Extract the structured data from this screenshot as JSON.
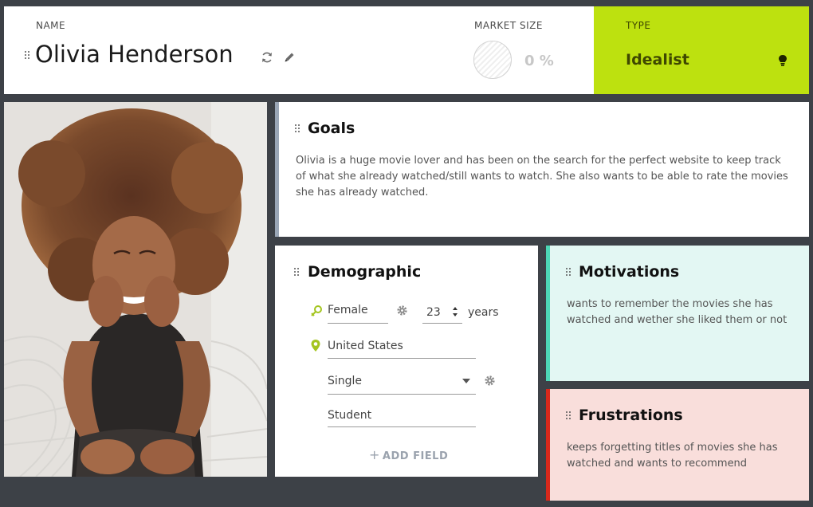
{
  "header": {
    "name_caption": "NAME",
    "persona_name": "Olivia Henderson",
    "market_size_caption": "MARKET SIZE",
    "market_size_value": "0 %",
    "type_caption": "TYPE",
    "type_value": "Idealist"
  },
  "goals": {
    "title": "Goals",
    "text": "Olivia is a huge movie lover and has been on the search for the perfect website to keep track of what she already watched/still wants to watch. She also wants to be able to rate the movies she has already watched."
  },
  "demographic": {
    "title": "Demographic",
    "gender": "Female",
    "age": "23",
    "age_unit": "years",
    "location": "United States",
    "relationship": "Single",
    "occupation": "Student",
    "add_field_label": "ADD FIELD"
  },
  "motivations": {
    "title": "Motivations",
    "text": "wants to remember the movies she has watched and wether she liked them or not"
  },
  "frustrations": {
    "title": "Frustrations",
    "text": "keeps forgetting titles of movies she has watched and wants to recommend"
  },
  "colors": {
    "type_accent": "#bde10f",
    "goals_accent": "#9aa6b6",
    "motivations_accent": "#4dd6b5",
    "frustrations_accent": "#d8281b",
    "demographic_icon": "#a4c520"
  },
  "icons": [
    "drag-handle-icon",
    "refresh-icon",
    "pencil-icon",
    "lightbulb-icon",
    "gender-icon",
    "gear-icon",
    "location-pin-icon",
    "dropdown-arrow-icon",
    "plus-icon"
  ]
}
